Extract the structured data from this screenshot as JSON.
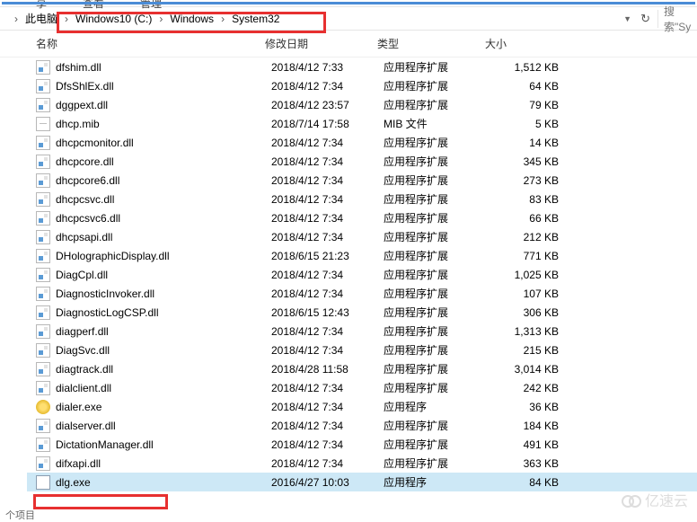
{
  "topbar": {
    "m1": "享",
    "m2": "查看",
    "m3": "管理"
  },
  "breadcrumb": {
    "root": "此电脑",
    "parts": [
      "Windows10 (C:)",
      "Windows",
      "System32"
    ]
  },
  "search_hint": "搜索\"Sy",
  "columns": {
    "name": "名称",
    "date": "修改日期",
    "type": "类型",
    "size": "大小"
  },
  "types": {
    "dll": "应用程序扩展",
    "mib": "MIB 文件",
    "exe": "应用程序"
  },
  "files": [
    {
      "n": "dfshim.dll",
      "d": "2018/4/12 7:33",
      "t": "dll",
      "s": "1,512 KB",
      "i": "dll"
    },
    {
      "n": "DfsShlEx.dll",
      "d": "2018/4/12 7:34",
      "t": "dll",
      "s": "64 KB",
      "i": "dll"
    },
    {
      "n": "dggpext.dll",
      "d": "2018/4/12 23:57",
      "t": "dll",
      "s": "79 KB",
      "i": "dll"
    },
    {
      "n": "dhcp.mib",
      "d": "2018/7/14 17:58",
      "t": "mib",
      "s": "5 KB",
      "i": "file"
    },
    {
      "n": "dhcpcmonitor.dll",
      "d": "2018/4/12 7:34",
      "t": "dll",
      "s": "14 KB",
      "i": "dll"
    },
    {
      "n": "dhcpcore.dll",
      "d": "2018/4/12 7:34",
      "t": "dll",
      "s": "345 KB",
      "i": "dll"
    },
    {
      "n": "dhcpcore6.dll",
      "d": "2018/4/12 7:34",
      "t": "dll",
      "s": "273 KB",
      "i": "dll"
    },
    {
      "n": "dhcpcsvc.dll",
      "d": "2018/4/12 7:34",
      "t": "dll",
      "s": "83 KB",
      "i": "dll"
    },
    {
      "n": "dhcpcsvc6.dll",
      "d": "2018/4/12 7:34",
      "t": "dll",
      "s": "66 KB",
      "i": "dll"
    },
    {
      "n": "dhcpsapi.dll",
      "d": "2018/4/12 7:34",
      "t": "dll",
      "s": "212 KB",
      "i": "dll"
    },
    {
      "n": "DHolographicDisplay.dll",
      "d": "2018/6/15 21:23",
      "t": "dll",
      "s": "771 KB",
      "i": "dll"
    },
    {
      "n": "DiagCpl.dll",
      "d": "2018/4/12 7:34",
      "t": "dll",
      "s": "1,025 KB",
      "i": "dll"
    },
    {
      "n": "DiagnosticInvoker.dll",
      "d": "2018/4/12 7:34",
      "t": "dll",
      "s": "107 KB",
      "i": "dll"
    },
    {
      "n": "DiagnosticLogCSP.dll",
      "d": "2018/6/15 12:43",
      "t": "dll",
      "s": "306 KB",
      "i": "dll"
    },
    {
      "n": "diagperf.dll",
      "d": "2018/4/12 7:34",
      "t": "dll",
      "s": "1,313 KB",
      "i": "dll"
    },
    {
      "n": "DiagSvc.dll",
      "d": "2018/4/12 7:34",
      "t": "dll",
      "s": "215 KB",
      "i": "dll"
    },
    {
      "n": "diagtrack.dll",
      "d": "2018/4/28 11:58",
      "t": "dll",
      "s": "3,014 KB",
      "i": "dll"
    },
    {
      "n": "dialclient.dll",
      "d": "2018/4/12 7:34",
      "t": "dll",
      "s": "242 KB",
      "i": "dll"
    },
    {
      "n": "dialer.exe",
      "d": "2018/4/12 7:34",
      "t": "exe",
      "s": "36 KB",
      "i": "dialer"
    },
    {
      "n": "dialserver.dll",
      "d": "2018/4/12 7:34",
      "t": "dll",
      "s": "184 KB",
      "i": "dll"
    },
    {
      "n": "DictationManager.dll",
      "d": "2018/4/12 7:34",
      "t": "dll",
      "s": "491 KB",
      "i": "dll"
    },
    {
      "n": "difxapi.dll",
      "d": "2018/4/12 7:34",
      "t": "dll",
      "s": "363 KB",
      "i": "dll"
    },
    {
      "n": "dlg.exe",
      "d": "2016/4/27 10:03",
      "t": "exe",
      "s": "84 KB",
      "i": "exe",
      "sel": true
    }
  ],
  "status": "个项目",
  "watermark": "亿速云"
}
